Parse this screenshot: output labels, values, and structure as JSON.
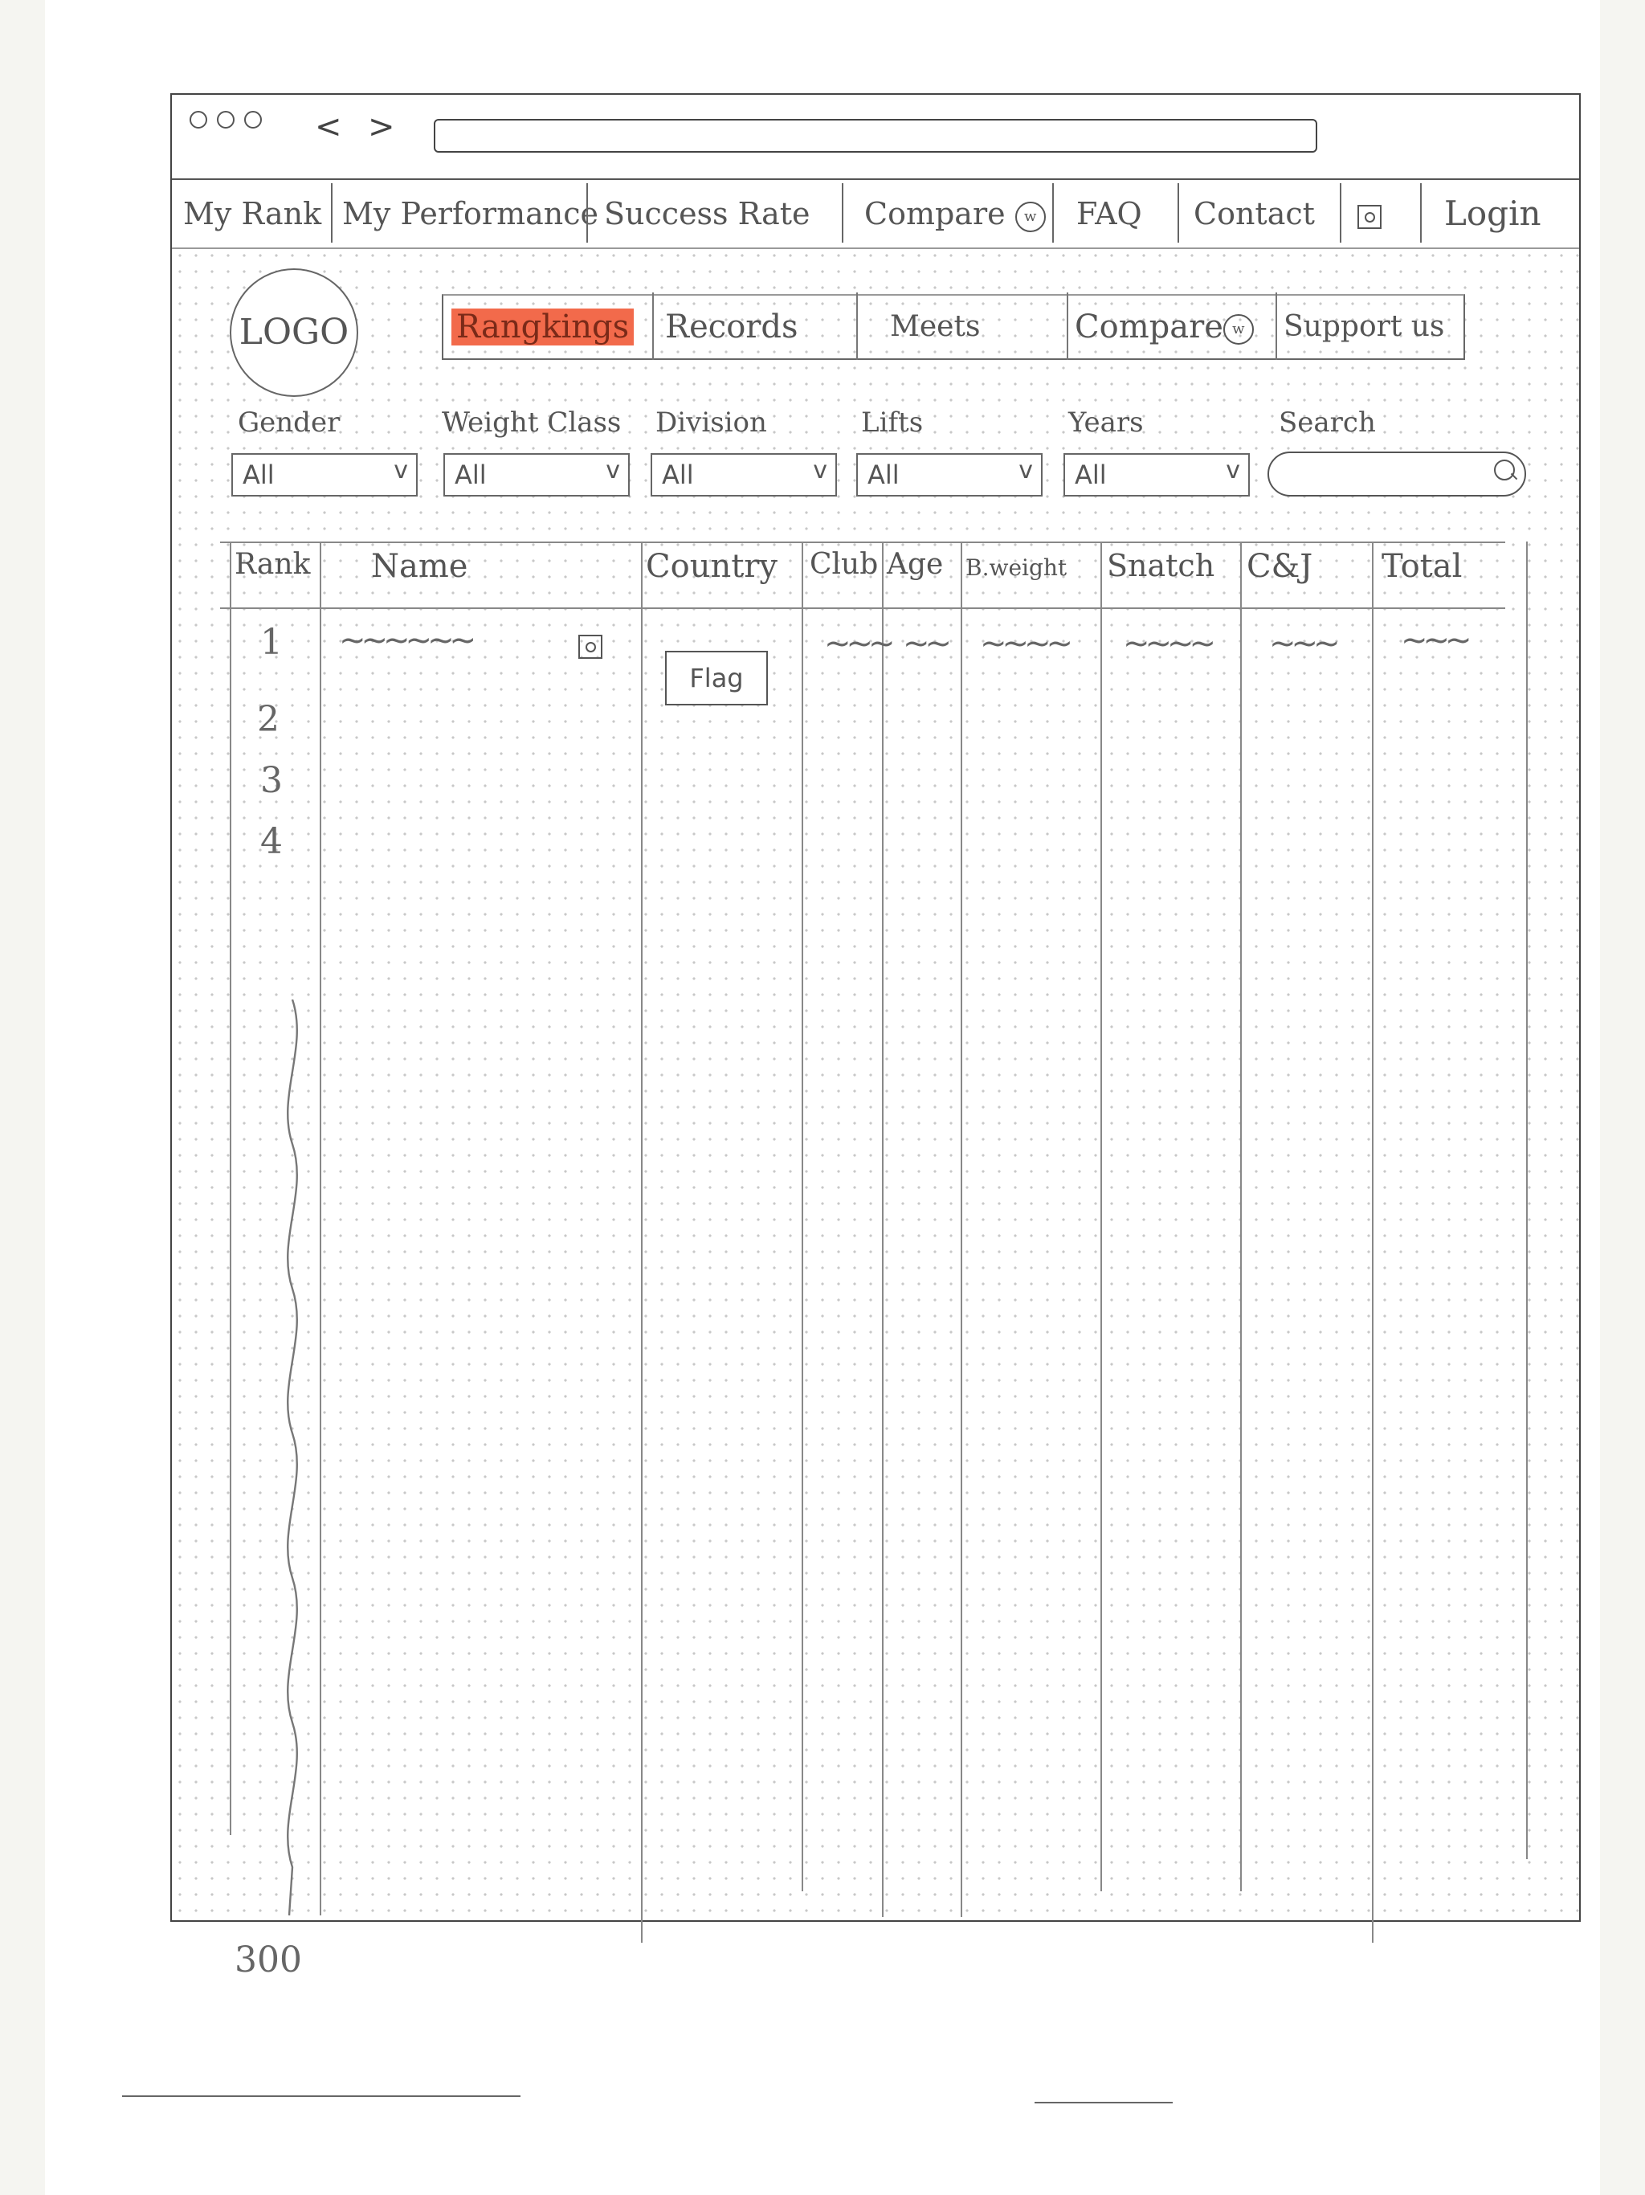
{
  "browser": {
    "nav_back": "<",
    "nav_forward": ">",
    "url": ""
  },
  "topnav": {
    "items": [
      "My Rank",
      "My Performance",
      "Success Rate",
      "Compare",
      "FAQ",
      "Contact",
      "Login"
    ],
    "compare_badge": "w",
    "camera_icon": "camera-icon"
  },
  "logo": "LOGO",
  "subnav": {
    "items": [
      "Rangkings",
      "Records",
      "Meets",
      "Compare",
      "Support us"
    ],
    "active": "Rangkings",
    "compare_badge": "w",
    "highlight_color": "#f26a4b"
  },
  "filters": {
    "labels": [
      "Gender",
      "Weight Class",
      "Division",
      "Lifts",
      "Years",
      "Search"
    ],
    "values": [
      "All",
      "All",
      "All",
      "All",
      "All"
    ],
    "search_placeholder": ""
  },
  "table": {
    "headers": [
      "Rank",
      "Name",
      "Country",
      "Club",
      "Age",
      "B.weight",
      "Snatch",
      "C&J",
      "Total"
    ],
    "ranks": [
      "1",
      "2",
      "3",
      "4",
      "300"
    ],
    "flag_label": "Flag"
  }
}
